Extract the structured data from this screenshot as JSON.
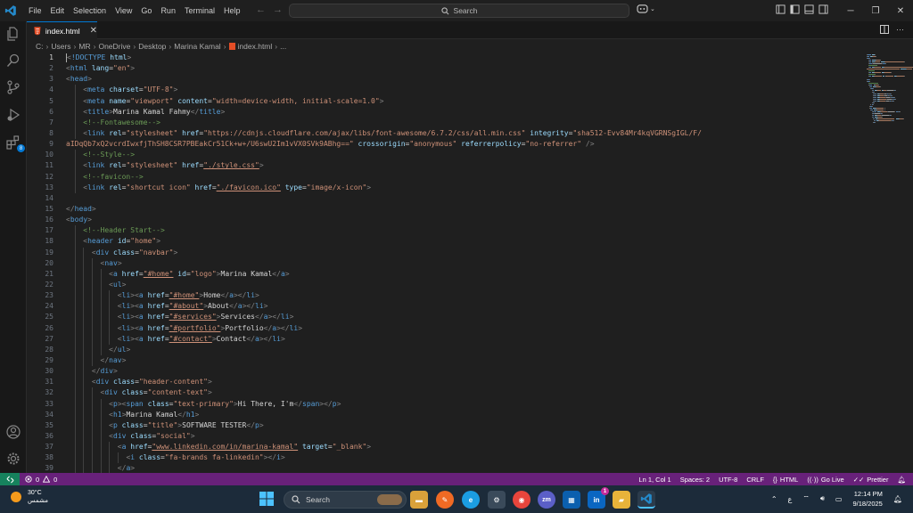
{
  "menu": [
    "File",
    "Edit",
    "Selection",
    "View",
    "Go",
    "Run",
    "Terminal",
    "Help"
  ],
  "search_placeholder": "Search",
  "tab": {
    "label": "index.html",
    "close": "✕"
  },
  "breadcrumb": [
    "C:",
    "Users",
    "MR",
    "OneDrive",
    "Desktop",
    "Marina Kamal",
    "index.html",
    "..."
  ],
  "activity_badge": "8",
  "code_lines": [
    [
      [
        "b",
        "<"
      ],
      [
        "t",
        "!DOCTYPE"
      ],
      [
        "x",
        " "
      ],
      [
        "a",
        "html"
      ],
      [
        "b",
        ">"
      ]
    ],
    [
      [
        "b",
        "<"
      ],
      [
        "t",
        "html"
      ],
      [
        "x",
        " "
      ],
      [
        "a",
        "lang"
      ],
      [
        "x",
        "="
      ],
      [
        "s",
        "\"en\""
      ],
      [
        "b",
        ">"
      ]
    ],
    [
      [
        "b",
        "<"
      ],
      [
        "t",
        "head"
      ],
      [
        "b",
        ">"
      ]
    ],
    [
      [
        "x",
        "    "
      ],
      [
        "b",
        "<"
      ],
      [
        "t",
        "meta"
      ],
      [
        "x",
        " "
      ],
      [
        "a",
        "charset"
      ],
      [
        "x",
        "="
      ],
      [
        "s",
        "\"UTF-8\""
      ],
      [
        "b",
        ">"
      ]
    ],
    [
      [
        "x",
        "    "
      ],
      [
        "b",
        "<"
      ],
      [
        "t",
        "meta"
      ],
      [
        "x",
        " "
      ],
      [
        "a",
        "name"
      ],
      [
        "x",
        "="
      ],
      [
        "s",
        "\"viewport\""
      ],
      [
        "x",
        " "
      ],
      [
        "a",
        "content"
      ],
      [
        "x",
        "="
      ],
      [
        "s",
        "\"width=device-width, initial-scale=1.0\""
      ],
      [
        "b",
        ">"
      ]
    ],
    [
      [
        "x",
        "    "
      ],
      [
        "b",
        "<"
      ],
      [
        "t",
        "title"
      ],
      [
        "b",
        ">"
      ],
      [
        "x",
        "Marina Kamal Fahmy"
      ],
      [
        "b",
        "</"
      ],
      [
        "t",
        "title"
      ],
      [
        "b",
        ">"
      ]
    ],
    [
      [
        "x",
        "    "
      ],
      [
        "c",
        "<!--Fontawesome-->"
      ]
    ],
    [
      [
        "x",
        "    "
      ],
      [
        "b",
        "<"
      ],
      [
        "t",
        "link"
      ],
      [
        "x",
        " "
      ],
      [
        "a",
        "rel"
      ],
      [
        "x",
        "="
      ],
      [
        "s",
        "\"stylesheet\""
      ],
      [
        "x",
        " "
      ],
      [
        "a",
        "href"
      ],
      [
        "x",
        "="
      ],
      [
        "s",
        "\"https://cdnjs.cloudflare.com/ajax/libs/font-awesome/6.7.2/css/all.min.css\""
      ],
      [
        "x",
        " "
      ],
      [
        "a",
        "integrity"
      ],
      [
        "x",
        "="
      ],
      [
        "s",
        "\"sha512-Evv84Mr4kqVGRNSgIGL/F/"
      ]
    ],
    [
      [
        "s",
        "aIDqQb7xQ2vcrdIwxfjThSH8CSR7PBEakCr51Ck+w+/U6swU2Im1vVX0SVk9ABhg==\""
      ],
      [
        "x",
        " "
      ],
      [
        "a",
        "crossorigin"
      ],
      [
        "x",
        "="
      ],
      [
        "s",
        "\"anonymous\""
      ],
      [
        "x",
        " "
      ],
      [
        "a",
        "referrerpolicy"
      ],
      [
        "x",
        "="
      ],
      [
        "s",
        "\"no-referrer\""
      ],
      [
        "x",
        " "
      ],
      [
        "b",
        "/>"
      ]
    ],
    [
      [
        "x",
        "    "
      ],
      [
        "c",
        "<!--Style-->"
      ]
    ],
    [
      [
        "x",
        "    "
      ],
      [
        "b",
        "<"
      ],
      [
        "t",
        "link"
      ],
      [
        "x",
        " "
      ],
      [
        "a",
        "rel"
      ],
      [
        "x",
        "="
      ],
      [
        "s",
        "\"stylesheet\""
      ],
      [
        "x",
        " "
      ],
      [
        "a",
        "href"
      ],
      [
        "x",
        "="
      ],
      [
        "l",
        "\"./style.css\""
      ],
      [
        "b",
        ">"
      ]
    ],
    [
      [
        "x",
        "    "
      ],
      [
        "c",
        "<!--favicon-->"
      ]
    ],
    [
      [
        "x",
        "    "
      ],
      [
        "b",
        "<"
      ],
      [
        "t",
        "link"
      ],
      [
        "x",
        " "
      ],
      [
        "a",
        "rel"
      ],
      [
        "x",
        "="
      ],
      [
        "s",
        "\"shortcut icon\""
      ],
      [
        "x",
        " "
      ],
      [
        "a",
        "href"
      ],
      [
        "x",
        "="
      ],
      [
        "l",
        "\"./favicon.ico\""
      ],
      [
        "x",
        " "
      ],
      [
        "a",
        "type"
      ],
      [
        "x",
        "="
      ],
      [
        "s",
        "\"image/x-icon\""
      ],
      [
        "b",
        ">"
      ]
    ],
    [],
    [
      [
        "b",
        "</"
      ],
      [
        "t",
        "head"
      ],
      [
        "b",
        ">"
      ]
    ],
    [
      [
        "b",
        "<"
      ],
      [
        "t",
        "body"
      ],
      [
        "b",
        ">"
      ]
    ],
    [
      [
        "x",
        "    "
      ],
      [
        "c",
        "<!--Header Start-->"
      ]
    ],
    [
      [
        "x",
        "    "
      ],
      [
        "b",
        "<"
      ],
      [
        "t",
        "header"
      ],
      [
        "x",
        " "
      ],
      [
        "a",
        "id"
      ],
      [
        "x",
        "="
      ],
      [
        "s",
        "\"home\""
      ],
      [
        "b",
        ">"
      ]
    ],
    [
      [
        "x",
        "      "
      ],
      [
        "b",
        "<"
      ],
      [
        "t",
        "div"
      ],
      [
        "x",
        " "
      ],
      [
        "a",
        "class"
      ],
      [
        "x",
        "="
      ],
      [
        "s",
        "\"navbar\""
      ],
      [
        "b",
        ">"
      ]
    ],
    [
      [
        "x",
        "        "
      ],
      [
        "b",
        "<"
      ],
      [
        "t",
        "nav"
      ],
      [
        "b",
        ">"
      ]
    ],
    [
      [
        "x",
        "          "
      ],
      [
        "b",
        "<"
      ],
      [
        "t",
        "a"
      ],
      [
        "x",
        " "
      ],
      [
        "a",
        "href"
      ],
      [
        "x",
        "="
      ],
      [
        "l",
        "\"#home\""
      ],
      [
        "x",
        " "
      ],
      [
        "a",
        "id"
      ],
      [
        "x",
        "="
      ],
      [
        "s",
        "\"logo\""
      ],
      [
        "b",
        ">"
      ],
      [
        "x",
        "Marina Kamal"
      ],
      [
        "b",
        "</"
      ],
      [
        "t",
        "a"
      ],
      [
        "b",
        ">"
      ]
    ],
    [
      [
        "x",
        "          "
      ],
      [
        "b",
        "<"
      ],
      [
        "t",
        "ul"
      ],
      [
        "b",
        ">"
      ]
    ],
    [
      [
        "x",
        "            "
      ],
      [
        "b",
        "<"
      ],
      [
        "t",
        "li"
      ],
      [
        "b",
        "><"
      ],
      [
        "t",
        "a"
      ],
      [
        "x",
        " "
      ],
      [
        "a",
        "href"
      ],
      [
        "x",
        "="
      ],
      [
        "l",
        "\"#home\""
      ],
      [
        "b",
        ">"
      ],
      [
        "x",
        "Home"
      ],
      [
        "b",
        "</"
      ],
      [
        "t",
        "a"
      ],
      [
        "b",
        "></"
      ],
      [
        "t",
        "li"
      ],
      [
        "b",
        ">"
      ]
    ],
    [
      [
        "x",
        "            "
      ],
      [
        "b",
        "<"
      ],
      [
        "t",
        "li"
      ],
      [
        "b",
        "><"
      ],
      [
        "t",
        "a"
      ],
      [
        "x",
        " "
      ],
      [
        "a",
        "href"
      ],
      [
        "x",
        "="
      ],
      [
        "l",
        "\"#about\""
      ],
      [
        "b",
        ">"
      ],
      [
        "x",
        "About"
      ],
      [
        "b",
        "</"
      ],
      [
        "t",
        "a"
      ],
      [
        "b",
        "></"
      ],
      [
        "t",
        "li"
      ],
      [
        "b",
        ">"
      ]
    ],
    [
      [
        "x",
        "            "
      ],
      [
        "b",
        "<"
      ],
      [
        "t",
        "li"
      ],
      [
        "b",
        "><"
      ],
      [
        "t",
        "a"
      ],
      [
        "x",
        " "
      ],
      [
        "a",
        "href"
      ],
      [
        "x",
        "="
      ],
      [
        "l",
        "\"#services\""
      ],
      [
        "b",
        ">"
      ],
      [
        "x",
        "Services"
      ],
      [
        "b",
        "</"
      ],
      [
        "t",
        "a"
      ],
      [
        "b",
        "></"
      ],
      [
        "t",
        "li"
      ],
      [
        "b",
        ">"
      ]
    ],
    [
      [
        "x",
        "            "
      ],
      [
        "b",
        "<"
      ],
      [
        "t",
        "li"
      ],
      [
        "b",
        "><"
      ],
      [
        "t",
        "a"
      ],
      [
        "x",
        " "
      ],
      [
        "a",
        "href"
      ],
      [
        "x",
        "="
      ],
      [
        "l",
        "\"#portfolio\""
      ],
      [
        "b",
        ">"
      ],
      [
        "x",
        "Portfolio"
      ],
      [
        "b",
        "</"
      ],
      [
        "t",
        "a"
      ],
      [
        "b",
        "></"
      ],
      [
        "t",
        "li"
      ],
      [
        "b",
        ">"
      ]
    ],
    [
      [
        "x",
        "            "
      ],
      [
        "b",
        "<"
      ],
      [
        "t",
        "li"
      ],
      [
        "b",
        "><"
      ],
      [
        "t",
        "a"
      ],
      [
        "x",
        " "
      ],
      [
        "a",
        "href"
      ],
      [
        "x",
        "="
      ],
      [
        "l",
        "\"#contact\""
      ],
      [
        "b",
        ">"
      ],
      [
        "x",
        "Contact"
      ],
      [
        "b",
        "</"
      ],
      [
        "t",
        "a"
      ],
      [
        "b",
        "></"
      ],
      [
        "t",
        "li"
      ],
      [
        "b",
        ">"
      ]
    ],
    [
      [
        "x",
        "          "
      ],
      [
        "b",
        "</"
      ],
      [
        "t",
        "ul"
      ],
      [
        "b",
        ">"
      ]
    ],
    [
      [
        "x",
        "        "
      ],
      [
        "b",
        "</"
      ],
      [
        "t",
        "nav"
      ],
      [
        "b",
        ">"
      ]
    ],
    [
      [
        "x",
        "      "
      ],
      [
        "b",
        "</"
      ],
      [
        "t",
        "div"
      ],
      [
        "b",
        ">"
      ]
    ],
    [
      [
        "x",
        "      "
      ],
      [
        "b",
        "<"
      ],
      [
        "t",
        "div"
      ],
      [
        "x",
        " "
      ],
      [
        "a",
        "class"
      ],
      [
        "x",
        "="
      ],
      [
        "s",
        "\"header-content\""
      ],
      [
        "b",
        ">"
      ]
    ],
    [
      [
        "x",
        "        "
      ],
      [
        "b",
        "<"
      ],
      [
        "t",
        "div"
      ],
      [
        "x",
        " "
      ],
      [
        "a",
        "class"
      ],
      [
        "x",
        "="
      ],
      [
        "s",
        "\"content-text\""
      ],
      [
        "b",
        ">"
      ]
    ],
    [
      [
        "x",
        "          "
      ],
      [
        "b",
        "<"
      ],
      [
        "t",
        "p"
      ],
      [
        "b",
        "><"
      ],
      [
        "t",
        "span"
      ],
      [
        "x",
        " "
      ],
      [
        "a",
        "class"
      ],
      [
        "x",
        "="
      ],
      [
        "s",
        "\"text-primary\""
      ],
      [
        "b",
        ">"
      ],
      [
        "x",
        "Hi There, I'm"
      ],
      [
        "b",
        "</"
      ],
      [
        "t",
        "span"
      ],
      [
        "b",
        "></"
      ],
      [
        "t",
        "p"
      ],
      [
        "b",
        ">"
      ]
    ],
    [
      [
        "x",
        "          "
      ],
      [
        "b",
        "<"
      ],
      [
        "t",
        "h1"
      ],
      [
        "b",
        ">"
      ],
      [
        "x",
        "Marina Kamal"
      ],
      [
        "b",
        "</"
      ],
      [
        "t",
        "h1"
      ],
      [
        "b",
        ">"
      ]
    ],
    [
      [
        "x",
        "          "
      ],
      [
        "b",
        "<"
      ],
      [
        "t",
        "p"
      ],
      [
        "x",
        " "
      ],
      [
        "a",
        "class"
      ],
      [
        "x",
        "="
      ],
      [
        "s",
        "\"title\""
      ],
      [
        "b",
        ">"
      ],
      [
        "x",
        "SOFTWARE TESTER"
      ],
      [
        "b",
        "</"
      ],
      [
        "t",
        "p"
      ],
      [
        "b",
        ">"
      ]
    ],
    [
      [
        "x",
        "          "
      ],
      [
        "b",
        "<"
      ],
      [
        "t",
        "div"
      ],
      [
        "x",
        " "
      ],
      [
        "a",
        "class"
      ],
      [
        "x",
        "="
      ],
      [
        "s",
        "\"social\""
      ],
      [
        "b",
        ">"
      ]
    ],
    [
      [
        "x",
        "            "
      ],
      [
        "b",
        "<"
      ],
      [
        "t",
        "a"
      ],
      [
        "x",
        " "
      ],
      [
        "a",
        "href"
      ],
      [
        "x",
        "="
      ],
      [
        "l",
        "\"www.linkedin.com/in/marina-kamal\""
      ],
      [
        "x",
        " "
      ],
      [
        "a",
        "target"
      ],
      [
        "x",
        "="
      ],
      [
        "s",
        "\"_blank\""
      ],
      [
        "b",
        ">"
      ]
    ],
    [
      [
        "x",
        "              "
      ],
      [
        "b",
        "<"
      ],
      [
        "t",
        "i"
      ],
      [
        "x",
        " "
      ],
      [
        "a",
        "class"
      ],
      [
        "x",
        "="
      ],
      [
        "s",
        "\"fa-brands fa-linkedin\""
      ],
      [
        "b",
        "></"
      ],
      [
        "t",
        "i"
      ],
      [
        "b",
        ">"
      ]
    ],
    [
      [
        "x",
        "            "
      ],
      [
        "b",
        "</"
      ],
      [
        "t",
        "a"
      ],
      [
        "b",
        ">"
      ]
    ]
  ],
  "status": {
    "errors": "0",
    "warnings": "0",
    "position": "Ln 1, Col 1",
    "spaces": "Spaces: 2",
    "encoding": "UTF-8",
    "eol": "CRLF",
    "language": "HTML",
    "golive": "Go Live",
    "prettier": "Prettier"
  },
  "taskbar": {
    "temperature": "30°C",
    "weather_label": "مشمس",
    "search": "Search",
    "lang": "ع",
    "time": "12:14 PM",
    "date": "9/18/2025",
    "linkedin_badge": "1"
  },
  "colors": {
    "statusbar": "#68217a",
    "remote": "#16825d",
    "accent": "#0078d4"
  }
}
